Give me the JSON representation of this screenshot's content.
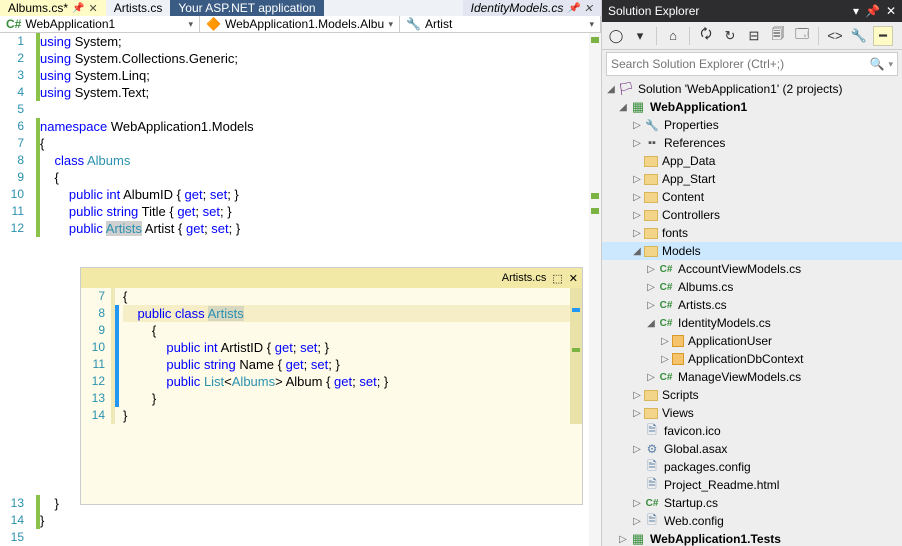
{
  "tabs": {
    "t1": "Albums.cs*",
    "t2": "Artists.cs",
    "t3": "Your ASP.NET application",
    "t4": "IdentityModels.cs"
  },
  "nav": {
    "project": "WebApplication1",
    "class": "WebApplication1.Models.Albu",
    "member": "Artist"
  },
  "code": {
    "l1": "using System;",
    "l2": "using System.Collections.Generic;",
    "l3": "using System.Linq;",
    "l4": "using System.Text;",
    "l5": "",
    "l6": "namespace WebApplication1.Models",
    "l7": "{",
    "l8": "    class Albums",
    "l9": "    {",
    "l10": "        public int AlbumID { get; set; }",
    "l11": "        public string Title { get; set; }",
    "l12": "        public Artists Artist { get; set; }",
    "l13": "    }",
    "l14": "}"
  },
  "peek": {
    "title": "Artists.cs",
    "l7": "{",
    "l8": "    public class Artists",
    "l9": "        {",
    "l10": "            public int ArtistID { get; set; }",
    "l11": "            public string Name { get; set; }",
    "l12": "            public List<Albums> Album { get; set; }",
    "l13": "        }",
    "l14": "}"
  },
  "se": {
    "title": "Solution Explorer",
    "search_ph": "Search Solution Explorer (Ctrl+;)",
    "sln": "Solution 'WebApplication1' (2 projects)",
    "proj": "WebApplication1",
    "properties": "Properties",
    "references": "References",
    "app_data": "App_Data",
    "app_start": "App_Start",
    "content": "Content",
    "controllers": "Controllers",
    "fonts": "fonts",
    "models": "Models",
    "m1": "AccountViewModels.cs",
    "m2": "Albums.cs",
    "m3": "Artists.cs",
    "m4": "IdentityModels.cs",
    "m4a": "ApplicationUser",
    "m4b": "ApplicationDbContext",
    "m5": "ManageViewModels.cs",
    "scripts": "Scripts",
    "views": "Views",
    "favicon": "favicon.ico",
    "global": "Global.asax",
    "packages": "packages.config",
    "readme": "Project_Readme.html",
    "startup": "Startup.cs",
    "webconfig": "Web.config",
    "tests": "WebApplication1.Tests"
  },
  "ln": {
    "n1": "1",
    "n2": "2",
    "n3": "3",
    "n4": "4",
    "n5": "5",
    "n6": "6",
    "n7": "7",
    "n8": "8",
    "n9": "9",
    "n10": "10",
    "n11": "11",
    "n12": "12",
    "n13": "13",
    "n14": "14",
    "n15": "15"
  }
}
